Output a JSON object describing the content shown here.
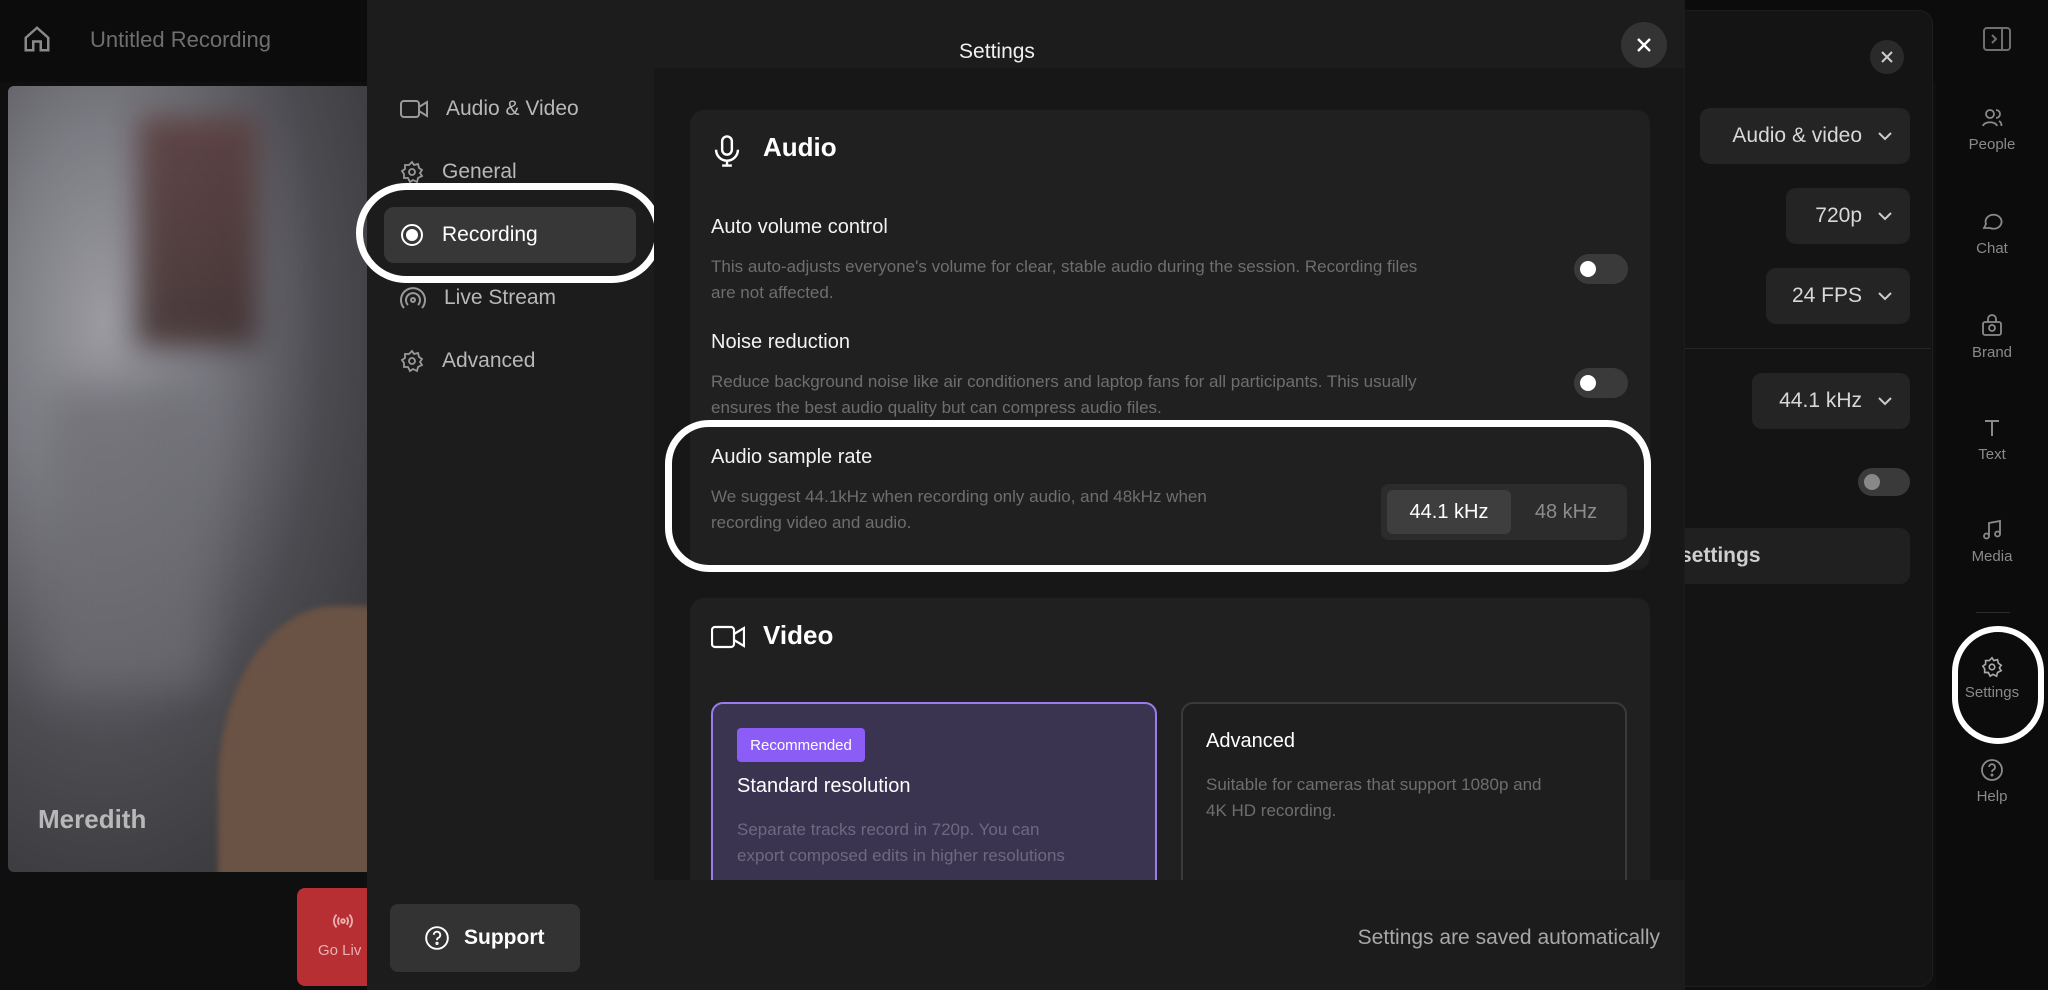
{
  "header": {
    "recording_title": "Untitled Recording"
  },
  "video": {
    "participant_name": "Meredith",
    "go_live_label": "Go Liv"
  },
  "right_panel": {
    "layout_select": "Audio & video",
    "resolution_select": "720p",
    "fps_select": "24 FPS",
    "sample_rate_select": "44.1 kHz",
    "settings_button": "settings"
  },
  "rail": {
    "items": [
      {
        "label": "People"
      },
      {
        "label": "Chat"
      },
      {
        "label": "Brand"
      },
      {
        "label": "Text"
      },
      {
        "label": "Media"
      },
      {
        "label": "Settings"
      },
      {
        "label": "Help"
      }
    ]
  },
  "modal": {
    "title": "Settings",
    "nav": [
      {
        "label": "Audio & Video"
      },
      {
        "label": "General"
      },
      {
        "label": "Recording"
      },
      {
        "label": "Live Stream"
      },
      {
        "label": "Advanced"
      }
    ],
    "active_nav": "Recording",
    "audio": {
      "title": "Audio",
      "auto_volume": {
        "label": "Auto volume control",
        "desc_line1": "This auto-adjusts everyone's volume for clear, stable audio during the session. Recording files",
        "desc_line2": "are not affected.",
        "enabled": false
      },
      "noise_reduction": {
        "label": "Noise reduction",
        "desc_line1": "Reduce background noise like air conditioners and laptop fans for all participants. This usually",
        "desc_line2": "ensures the best audio quality but can compress audio files.",
        "enabled": false
      },
      "sample_rate": {
        "label": "Audio sample rate",
        "desc_line1": "We suggest 44.1kHz when recording only audio, and 48kHz when",
        "desc_line2": "recording video and audio.",
        "options": [
          "44.1 kHz",
          "48 kHz"
        ],
        "selected": "44.1 kHz"
      }
    },
    "video": {
      "title": "Video",
      "standard": {
        "badge": "Recommended",
        "title": "Standard resolution",
        "desc_line1": "Separate tracks record in 720p. You can",
        "desc_line2": "export composed edits in higher resolutions"
      },
      "advanced": {
        "title": "Advanced",
        "desc_line1": "Suitable for cameras that support 1080p and",
        "desc_line2": "4K HD recording."
      }
    },
    "footer": {
      "support_label": "Support",
      "saved_note": "Settings are saved automatically"
    }
  },
  "colors": {
    "accent": "#8b5cf6",
    "go_live": "#b72e33",
    "modal_bg": "#1c1c1c"
  }
}
